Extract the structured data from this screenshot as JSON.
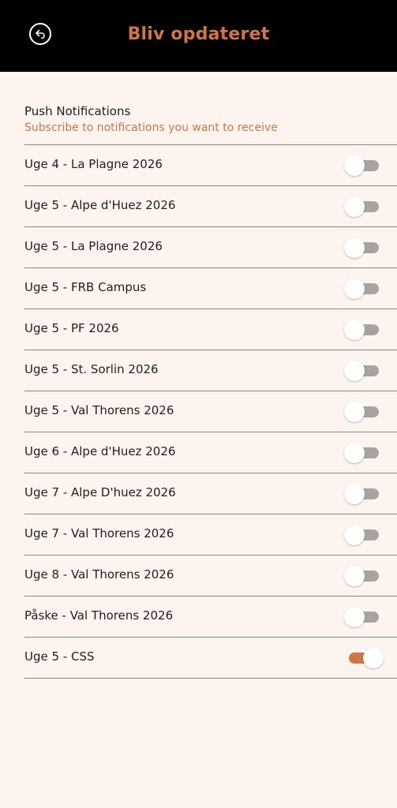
{
  "header": {
    "title": "Bliv opdateret",
    "back_icon": "back-arrow-circle-icon"
  },
  "section": {
    "title": "Push Notifications",
    "subtitle": "Subscribe to notifications you want to receive"
  },
  "colors": {
    "accent": "#d27544",
    "header_bg": "#000000",
    "page_bg": "#fdf4ef",
    "toggle_off": "#a8a3a0"
  },
  "items": [
    {
      "label": "Uge 4 - La Plagne 2026",
      "enabled": false
    },
    {
      "label": "Uge 5 - Alpe d'Huez 2026",
      "enabled": false
    },
    {
      "label": "Uge 5 - La Plagne 2026",
      "enabled": false
    },
    {
      "label": "Uge 5 - FRB Campus",
      "enabled": false
    },
    {
      "label": "Uge 5 - PF 2026",
      "enabled": false
    },
    {
      "label": "Uge 5 - St. Sorlin 2026",
      "enabled": false
    },
    {
      "label": "Uge 5 - Val Thorens 2026",
      "enabled": false
    },
    {
      "label": "Uge 6 - Alpe d'Huez 2026",
      "enabled": false
    },
    {
      "label": "Uge 7 - Alpe D'huez 2026",
      "enabled": false
    },
    {
      "label": "Uge 7 - Val Thorens 2026",
      "enabled": false
    },
    {
      "label": "Uge 8 - Val Thorens 2026",
      "enabled": false
    },
    {
      "label": "Påske - Val Thorens 2026",
      "enabled": false
    },
    {
      "label": "Uge 5 - CSS",
      "enabled": true
    }
  ]
}
